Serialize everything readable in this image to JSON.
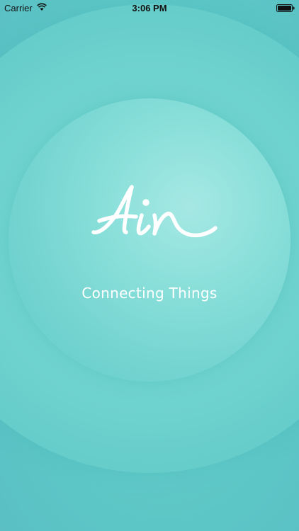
{
  "status_bar": {
    "carrier": "Carrier",
    "time": "3:06 PM",
    "wifi_icon": "wifi-icon",
    "battery_icon": "battery-icon"
  },
  "splash": {
    "logo_text": "Air",
    "tagline": "Connecting Things"
  },
  "colors": {
    "background": "#5cc6c6",
    "outer_ring": "#6dd1cd",
    "inner_circle": "#8ce0db",
    "text": "#ffffff"
  }
}
